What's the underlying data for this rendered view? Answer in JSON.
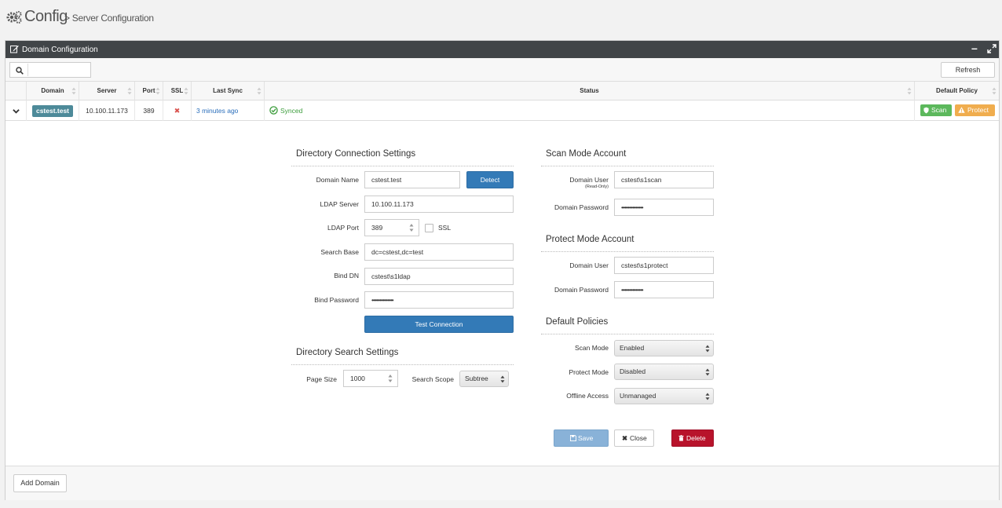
{
  "header": {
    "title": "Config",
    "breadcrumb": "> Server Configuration"
  },
  "panel": {
    "title": "Domain Configuration",
    "refresh_label": "Refresh",
    "search_placeholder": ""
  },
  "table": {
    "columns": [
      "Domain",
      "Server",
      "Port",
      "SSL",
      "Last Sync",
      "Status",
      "Default Policy"
    ],
    "row": {
      "domain": "cstest.test",
      "server": "10.100.11.173",
      "port": "389",
      "ssl": "✖",
      "last_sync": "3 minutes ago",
      "status": "Synced",
      "policy_scan": "Scan",
      "policy_protect": "Protect"
    }
  },
  "directory_connection": {
    "title": "Directory Connection Settings",
    "domain_name_label": "Domain Name",
    "domain_name_value": "cstest.test",
    "detect_label": "Detect",
    "ldap_server_label": "LDAP Server",
    "ldap_server_value": "10.100.11.173",
    "ldap_port_label": "LDAP Port",
    "ldap_port_value": "389",
    "ssl_label": "SSL",
    "search_base_label": "Search Base",
    "search_base_value": "dc=cstest,dc=test",
    "bind_dn_label": "Bind DN",
    "bind_dn_value": "cstest\\s1ldap",
    "bind_password_label": "Bind Password",
    "bind_password_value": "••••••••••••••",
    "test_connection_label": "Test Connection"
  },
  "directory_search": {
    "title": "Directory Search Settings",
    "page_size_label": "Page Size",
    "page_size_value": "1000",
    "search_scope_label": "Search Scope",
    "search_scope_value": "Subtree"
  },
  "scan_account": {
    "title": "Scan Mode Account",
    "user_label": "Domain User",
    "user_sublabel": "(Read-Only)",
    "user_value": "cstest\\s1scan",
    "password_label": "Domain Password",
    "password_value": "••••••••••••••"
  },
  "protect_account": {
    "title": "Protect Mode Account",
    "user_label": "Domain User",
    "user_value": "cstest\\s1protect",
    "password_label": "Domain Password",
    "password_value": "••••••••••••••"
  },
  "default_policies": {
    "title": "Default Policies",
    "scan_mode_label": "Scan Mode",
    "scan_mode_value": "Enabled",
    "protect_mode_label": "Protect Mode",
    "protect_mode_value": "Disabled",
    "offline_access_label": "Offline Access",
    "offline_access_value": "Unmanaged"
  },
  "actions": {
    "save_label": "Save",
    "close_label": "Close",
    "delete_label": "Delete"
  },
  "footer": {
    "add_domain_label": "Add Domain"
  },
  "colors": {
    "panel_bar": "#414548",
    "primary": "#337ab7",
    "domain_tag": "#4d8a99",
    "scan_badge": "#5cb85c",
    "protect_badge": "#f0ad4e",
    "delete": "#c9302c",
    "synced": "#3c9d3c",
    "link": "#2a6ebb"
  }
}
